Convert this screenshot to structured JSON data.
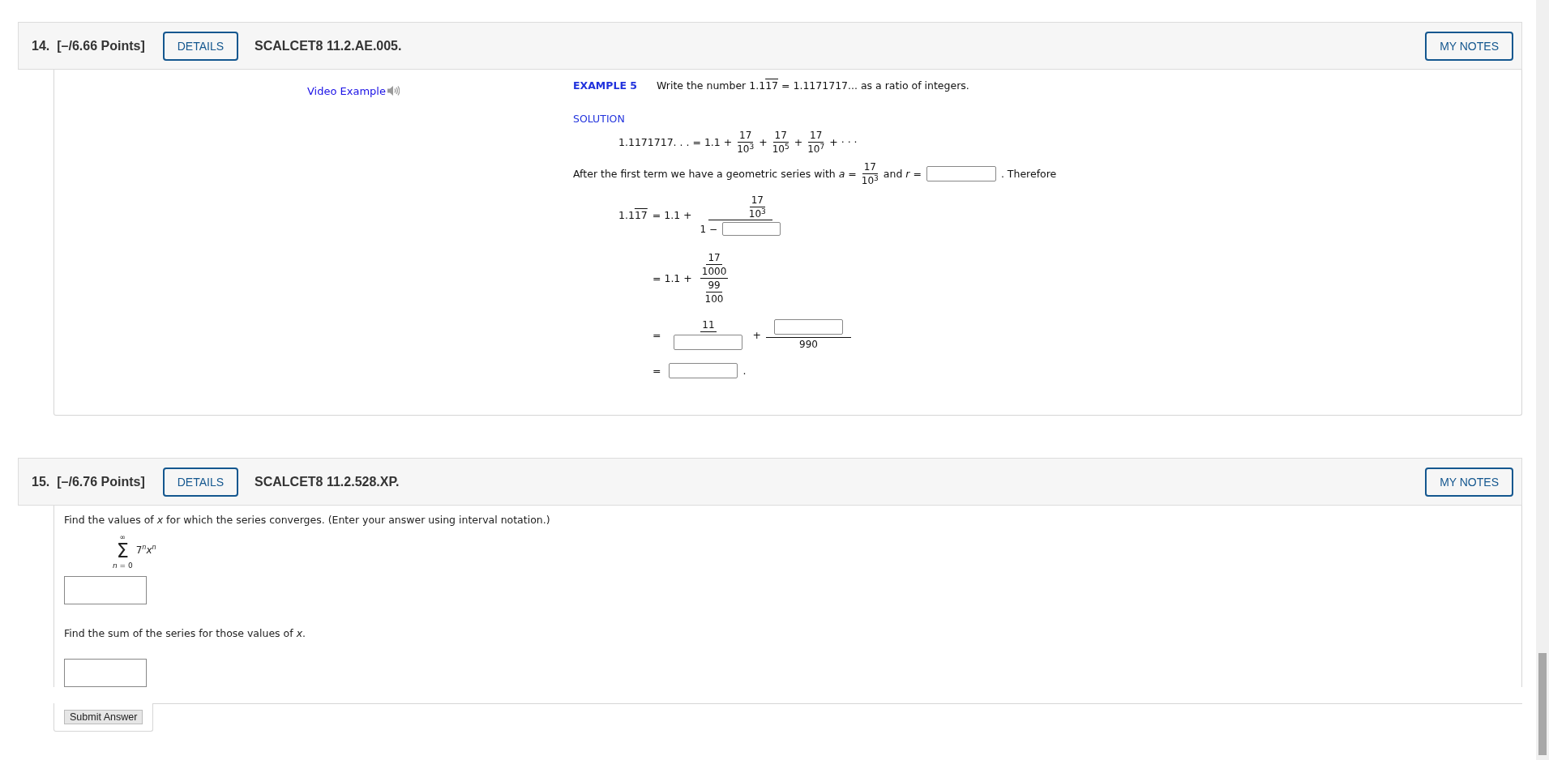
{
  "questions": [
    {
      "kind": "example",
      "number": "14.",
      "points": "[–/6.66 Points]",
      "details_button": "DETAILS",
      "code": "SCALCET8 11.2.AE.005.",
      "notes_button": "MY NOTES",
      "video_link": "Video Example",
      "example_label": "EXAMPLE 5",
      "prompt": {
        "before": "Write the number 1.1",
        "repeating": "17",
        "after": "= 1.1171717... as a ratio of integers."
      },
      "solution_label": "SOLUTION",
      "expansion": {
        "lhs": "1.1171717. . . = 1.1 +",
        "terms": [
          {
            "numerator": "17",
            "base": "10",
            "exponent": "3",
            "after": "+"
          },
          {
            "numerator": "17",
            "base": "10",
            "exponent": "5",
            "after": "+"
          },
          {
            "numerator": "17",
            "base": "10",
            "exponent": "7",
            "after": "+ · · ·"
          }
        ]
      },
      "geometric": {
        "before": "After the first term we have a geometric series with *a* =",
        "numerator": "17",
        "base": "10",
        "exponent": "3",
        "middle": "and *r* =",
        "after": ". Therefore"
      },
      "step1": {
        "lhs": "1.1",
        "repeating": "17",
        "equals": "= 1.1 +",
        "numerator": "17",
        "base": "10",
        "exponent": "3",
        "denominator_prefix": "1 −"
      },
      "step2": {
        "equals": "= 1.1 +",
        "top_numerator": "17",
        "top_denominator": "1000",
        "bottom_numerator": "99",
        "bottom_denominator": "100"
      },
      "step3": {
        "equals": "=",
        "left_numerator": "11",
        "plus": "+",
        "right_denominator": "990"
      },
      "step4": {
        "equals": "=",
        "after": "."
      }
    },
    {
      "kind": "question",
      "number": "15.",
      "points": "[–/6.76 Points]",
      "details_button": "DETAILS",
      "code": "SCALCET8 11.2.528.XP.",
      "notes_button": "MY NOTES",
      "parts": [
        {
          "prompt": "Find the values of *x* for which the series converges. (Enter your answer using interval notation.)",
          "series": {
            "upper": "∞",
            "sigma": "Σ",
            "lower": "*n* = 0",
            "term": "7$^{n}$*x*$^{n}$"
          }
        },
        {
          "prompt": "Find the sum of the series for those values of *x*."
        }
      ],
      "submit_button": "Submit Answer"
    }
  ]
}
